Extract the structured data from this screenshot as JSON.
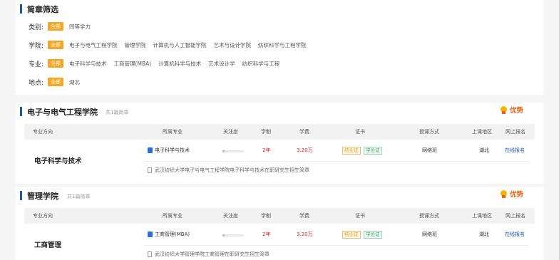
{
  "filter": {
    "title": "简章筛选",
    "category": {
      "label": "类别:",
      "all": "全部",
      "options": [
        "同等学力"
      ]
    },
    "college": {
      "label": "学院:",
      "all": "全部",
      "options": [
        "电子与电气工程学院",
        "管理学院",
        "计算机与人工智能学院",
        "艺术与设计学院",
        "纺织科学与工程学院"
      ]
    },
    "major": {
      "label": "专业:",
      "all": "全部",
      "options": [
        "电子科学与技术",
        "工商管理(MBA)",
        "计算机科学与技术",
        "艺术设计学",
        "纺织科学与工程"
      ]
    },
    "location": {
      "label": "地点:",
      "all": "全部",
      "options": [
        "湖北"
      ]
    }
  },
  "table_headers": [
    "专业方向",
    "所属专业",
    "关注度",
    "学制",
    "学费",
    "证书",
    "授课方式",
    "上课地区",
    "网上报名"
  ],
  "blocks": [
    {
      "college": "电子与电气工程学院",
      "count": "共1篇简章",
      "advantage": "优势",
      "direction": "电子科学与技术",
      "major": "电子科学与技术",
      "attention": 0.1,
      "duration": "2年",
      "fee": "3.20万",
      "cert1": "结业证",
      "cert2": "学位证",
      "mode": "网络班",
      "region": "湖北",
      "signup": "在线报名",
      "brochure": "武汉纺织大学电子与电气工程学院电子科学与技术在职研究生招生简章"
    },
    {
      "college": "管理学院",
      "count": "共1篇简章",
      "advantage": "优势",
      "direction": "工商管理",
      "major": "工商管理(MBA)",
      "attention": 0.1,
      "duration": "2年",
      "fee": "3.20万",
      "cert1": "结业证",
      "cert2": "学位证",
      "mode": "网络班",
      "region": "湖北",
      "signup": "在线报名",
      "brochure": "武汉纺织大学管理学院工商管理在职研究生招生简章"
    }
  ]
}
